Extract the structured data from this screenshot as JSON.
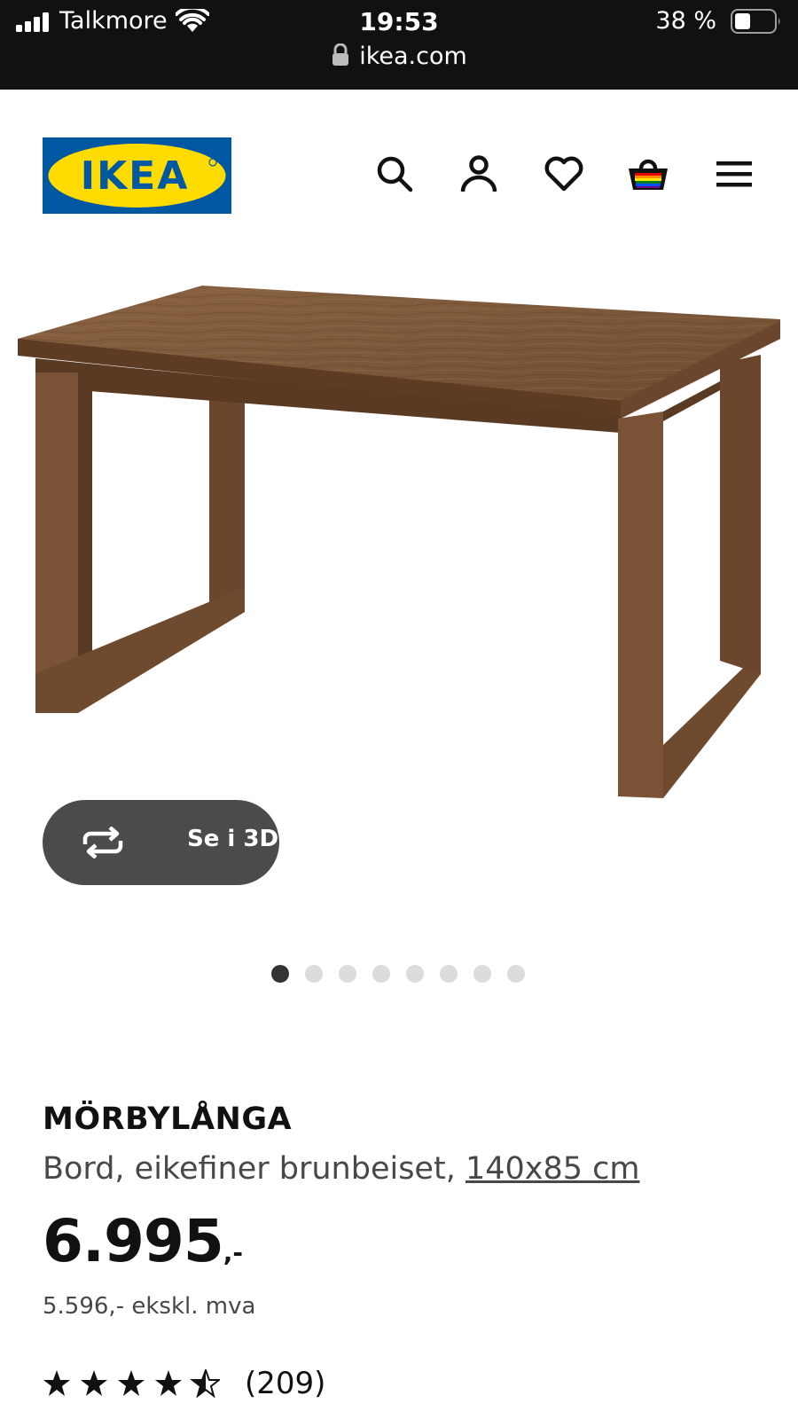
{
  "status_bar": {
    "carrier": "Talkmore",
    "time": "19:53",
    "battery": "38 %",
    "url": "ikea.com",
    "icons": [
      "signal-icon",
      "wifi-icon",
      "battery-icon",
      "lock-icon"
    ]
  },
  "header": {
    "logo_text": "IKEA",
    "icons": [
      "search-icon",
      "account-icon",
      "heart-icon",
      "basket-icon",
      "menu-icon"
    ]
  },
  "gallery": {
    "view_3d_label": "Se i 3D",
    "slide_count": 8,
    "active_slide": 1
  },
  "product": {
    "name": "MÖRBYLÅNGA",
    "description": "Bord, eikefiner brunbeiset, ",
    "size_link": "140x85 cm",
    "price_main": "6.995",
    "price_suffix": ",-",
    "price_ex_vat": "5.596,- ekskl. mva",
    "rating_stars": 4.5,
    "rating_count": "(209)"
  },
  "colors": {
    "ikea_blue": "#0058A3",
    "ikea_yellow": "#FFDB00",
    "wood": "#7a5537",
    "button_dark": "#4b4b4b"
  }
}
